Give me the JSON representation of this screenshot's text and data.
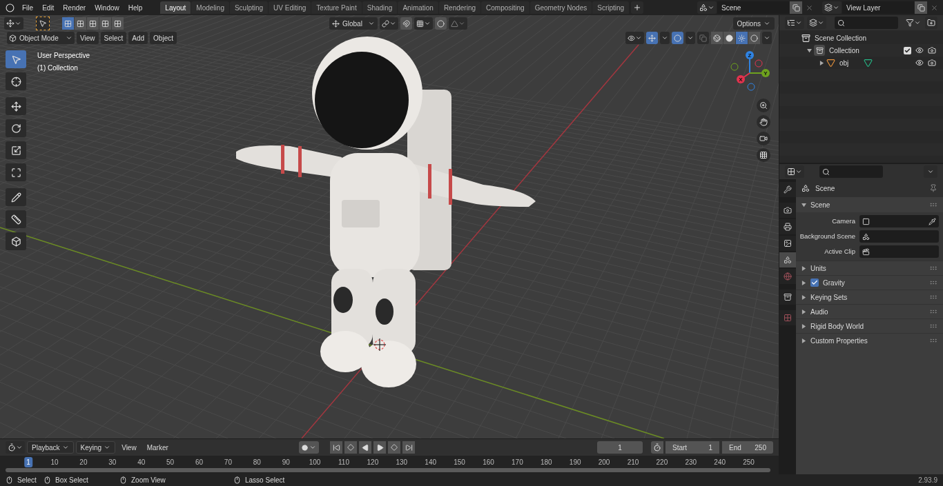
{
  "menu": [
    "File",
    "Edit",
    "Render",
    "Window",
    "Help"
  ],
  "workspaces": [
    {
      "label": "Layout",
      "selected": true
    },
    {
      "label": "Modeling",
      "selected": false
    },
    {
      "label": "Sculpting",
      "selected": false
    },
    {
      "label": "UV Editing",
      "selected": false
    },
    {
      "label": "Texture Paint",
      "selected": false
    },
    {
      "label": "Shading",
      "selected": false
    },
    {
      "label": "Animation",
      "selected": false
    },
    {
      "label": "Rendering",
      "selected": false
    },
    {
      "label": "Compositing",
      "selected": false
    },
    {
      "label": "Geometry Nodes",
      "selected": false
    },
    {
      "label": "Scripting",
      "selected": false
    }
  ],
  "scene": {
    "value": "Scene"
  },
  "view_layer": {
    "value": "View Layer"
  },
  "viewport": {
    "mode": "Object Mode",
    "menus": [
      "View",
      "Select",
      "Add",
      "Object"
    ],
    "orientation": "Global",
    "options": "Options",
    "info": [
      "User Perspective",
      "(1) Collection"
    ],
    "select_modes": [
      {
        "selected": true
      },
      {
        "selected": false
      },
      {
        "selected": false
      },
      {
        "selected": false
      },
      {
        "selected": false
      }
    ],
    "shading": [
      {
        "kind": "wireframe",
        "selected": false
      },
      {
        "kind": "solid",
        "selected": false
      },
      {
        "kind": "material",
        "selected": true
      },
      {
        "kind": "rendered",
        "selected": false
      }
    ],
    "tools": [
      {
        "kind": "select",
        "selected": true
      },
      {
        "kind": "cursor",
        "selected": false
      },
      {
        "kind": "move",
        "selected": false
      },
      {
        "kind": "rotate",
        "selected": false
      },
      {
        "kind": "scale",
        "selected": false
      },
      {
        "kind": "transform",
        "selected": false
      },
      {
        "kind": "annotate",
        "selected": false
      },
      {
        "kind": "measure",
        "selected": false
      },
      {
        "kind": "add_cube",
        "selected": false
      }
    ],
    "gizmo": [
      {
        "label": "Z",
        "color": "#2f83e3"
      },
      {
        "label": "Y",
        "color": "#6ea21e"
      },
      {
        "label": "X",
        "color": "#e2334e"
      }
    ]
  },
  "outliner": {
    "items": [
      {
        "label": "Scene Collection",
        "kind": "scene_collection",
        "children": [
          {
            "label": "Collection",
            "kind": "collection",
            "expanded": true,
            "checked": true,
            "children": [
              {
                "label": "obj",
                "kind": "object",
                "expanded": false
              }
            ]
          }
        ]
      }
    ]
  },
  "properties": {
    "tabs": [
      {
        "kind": "tool",
        "selected": false
      },
      {
        "kind": "render",
        "selected": false
      },
      {
        "kind": "output",
        "selected": false
      },
      {
        "kind": "view_layer",
        "selected": false
      },
      {
        "kind": "scene",
        "selected": true
      },
      {
        "kind": "world",
        "selected": false
      },
      {
        "kind": "collection",
        "selected": false
      },
      {
        "kind": "texture",
        "selected": false
      }
    ],
    "context": "Scene",
    "panel": {
      "label": "Scene",
      "expanded": true,
      "fields": [
        {
          "label": "Camera",
          "kind": "camera"
        },
        {
          "label": "Background Scene",
          "kind": "scene"
        },
        {
          "label": "Active Clip",
          "kind": "clip"
        }
      ]
    },
    "subpanels": [
      {
        "label": "Units",
        "expanded": false
      },
      {
        "label": "Gravity",
        "expanded": false,
        "checked": true
      },
      {
        "label": "Keying Sets",
        "expanded": false
      },
      {
        "label": "Audio",
        "expanded": false
      },
      {
        "label": "Rigid Body World",
        "expanded": false
      },
      {
        "label": "Custom Properties",
        "expanded": false
      }
    ]
  },
  "timeline": {
    "menus": [
      {
        "label": "Playback",
        "dropdown": true
      },
      {
        "label": "Keying",
        "dropdown": true
      },
      {
        "label": "View",
        "dropdown": false
      },
      {
        "label": "Marker",
        "dropdown": false
      }
    ],
    "current_frame": "1",
    "start": {
      "label": "Start",
      "value": "1"
    },
    "end": {
      "label": "End",
      "value": "250"
    },
    "ticks": [
      {
        "label": "1",
        "selected": true
      },
      {
        "label": "10",
        "selected": false
      },
      {
        "label": "20",
        "selected": false
      },
      {
        "label": "30",
        "selected": false
      },
      {
        "label": "40",
        "selected": false
      },
      {
        "label": "50",
        "selected": false
      },
      {
        "label": "60",
        "selected": false
      },
      {
        "label": "70",
        "selected": false
      },
      {
        "label": "80",
        "selected": false
      },
      {
        "label": "90",
        "selected": false
      },
      {
        "label": "100",
        "selected": false
      },
      {
        "label": "110",
        "selected": false
      },
      {
        "label": "120",
        "selected": false
      },
      {
        "label": "130",
        "selected": false
      },
      {
        "label": "140",
        "selected": false
      },
      {
        "label": "150",
        "selected": false
      },
      {
        "label": "160",
        "selected": false
      },
      {
        "label": "170",
        "selected": false
      },
      {
        "label": "180",
        "selected": false
      },
      {
        "label": "190",
        "selected": false
      },
      {
        "label": "200",
        "selected": false
      },
      {
        "label": "210",
        "selected": false
      },
      {
        "label": "220",
        "selected": false
      },
      {
        "label": "230",
        "selected": false
      },
      {
        "label": "240",
        "selected": false
      },
      {
        "label": "250",
        "selected": false
      }
    ]
  },
  "status": {
    "hints": [
      "Select",
      "Box Select",
      "Zoom View",
      "Lasso Select"
    ],
    "version": "2.93.9"
  }
}
